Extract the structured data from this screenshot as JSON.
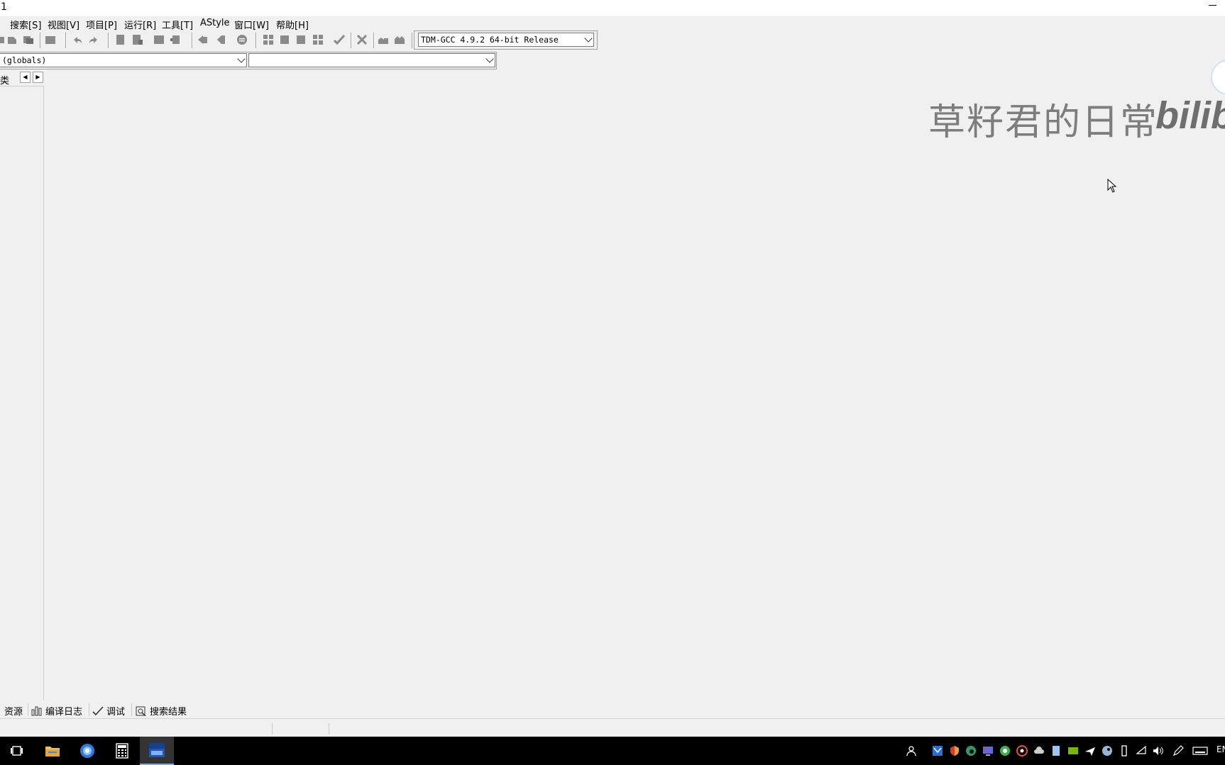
{
  "window": {
    "title": "1"
  },
  "menu": {
    "items": [
      "搜索[S]",
      "视图[V]",
      "项目[P]",
      "运行[R]",
      "工具[T]",
      "AStyle",
      "窗口[W]",
      "帮助[H]"
    ]
  },
  "toolbar": {
    "compiler_select": "TDM-GCC 4.9.2 64-bit Release"
  },
  "classbar": {
    "scope_select": "(globals)",
    "member_select": ""
  },
  "left_panel": {
    "tab_label": "类"
  },
  "watermark": {
    "text": "草籽君的日常",
    "latin": "bilibi"
  },
  "bottom_tabs": {
    "items": [
      "资源",
      "编译日志",
      "调试",
      "搜索结果"
    ]
  },
  "taskbar": {
    "tray_lang": "EN"
  }
}
